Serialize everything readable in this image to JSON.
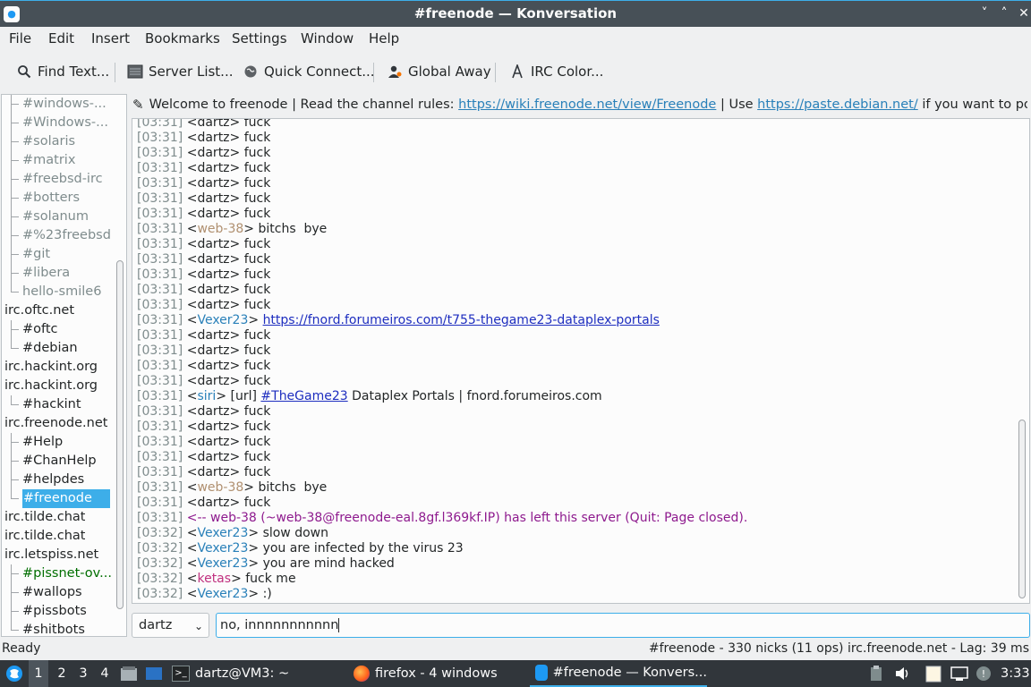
{
  "window": {
    "title": "#freenode — Konversation",
    "minimize": "˅",
    "maximize": "˄",
    "close": "✕"
  },
  "menu": [
    "File",
    "Edit",
    "Insert",
    "Bookmarks",
    "Settings",
    "Window",
    "Help"
  ],
  "toolbar": {
    "find": "Find Text...",
    "server_list": "Server List...",
    "quick_connect": "Quick Connect...",
    "global_away": "Global Away",
    "irc_color": "IRC Color..."
  },
  "sidebar": {
    "items": [
      {
        "label": "#windows-...",
        "level": 1,
        "color": "#7f8c8d"
      },
      {
        "label": "#Windows-...",
        "level": 1,
        "color": "#7f8c8d"
      },
      {
        "label": "#solaris",
        "level": 1,
        "color": "#7f8c8d"
      },
      {
        "label": "#matrix",
        "level": 1,
        "color": "#7f8c8d"
      },
      {
        "label": "#freebsd-irc",
        "level": 1,
        "color": "#7f8c8d"
      },
      {
        "label": "#botters",
        "level": 1,
        "color": "#7f8c8d"
      },
      {
        "label": "#solanum",
        "level": 1,
        "color": "#7f8c8d"
      },
      {
        "label": "#%23freebsd",
        "level": 1,
        "color": "#7f8c8d"
      },
      {
        "label": "#git",
        "level": 1,
        "color": "#7f8c8d"
      },
      {
        "label": "#libera",
        "level": 1,
        "color": "#7f8c8d"
      },
      {
        "label": "hello-smile6",
        "level": 1,
        "color": "#7f8c8d"
      },
      {
        "label": "irc.oftc.net",
        "level": 0,
        "color": "#232627"
      },
      {
        "label": "#oftc",
        "level": 1,
        "color": "#232627"
      },
      {
        "label": "#debian",
        "level": 1,
        "color": "#232627"
      },
      {
        "label": "irc.hackint.org",
        "level": 0,
        "color": "#232627"
      },
      {
        "label": "irc.hackint.org",
        "level": 0,
        "color": "#232627"
      },
      {
        "label": "#hackint",
        "level": 1,
        "color": "#232627"
      },
      {
        "label": "irc.freenode.net",
        "level": 0,
        "color": "#232627"
      },
      {
        "label": "#Help",
        "level": 1,
        "color": "#232627"
      },
      {
        "label": "#ChanHelp",
        "level": 1,
        "color": "#232627"
      },
      {
        "label": "#helpdes",
        "level": 1,
        "color": "#232627"
      },
      {
        "label": "#freenode",
        "level": 1,
        "color": "#ffffff",
        "selected": true
      },
      {
        "label": "irc.tilde.chat",
        "level": 0,
        "color": "#232627"
      },
      {
        "label": "irc.tilde.chat",
        "level": 0,
        "color": "#232627"
      },
      {
        "label": "irc.letspiss.net",
        "level": 0,
        "color": "#232627"
      },
      {
        "label": "#pissnet-ov...",
        "level": 1,
        "color": "#006e00"
      },
      {
        "label": "#wallops",
        "level": 1,
        "color": "#232627"
      },
      {
        "label": "#pissbots",
        "level": 1,
        "color": "#232627"
      },
      {
        "label": "#shitbots",
        "level": 1,
        "color": "#232627"
      }
    ]
  },
  "topic": {
    "prefix": "Welcome to freenode | Read the channel rules: ",
    "link1": "https://wiki.freenode.net/view/Freenode",
    "middle": " | Use ",
    "link2": "https://paste.debian.net/",
    "suffix": " if you want to post ..."
  },
  "chat": [
    {
      "ts": "[03:31]",
      "nick": "dartz",
      "text": "fuck"
    },
    {
      "ts": "[03:31]",
      "nick": "dartz",
      "text": "fuck"
    },
    {
      "ts": "[03:31]",
      "nick": "dartz",
      "text": "fuck"
    },
    {
      "ts": "[03:31]",
      "nick": "dartz",
      "text": "fuck"
    },
    {
      "ts": "[03:31]",
      "nick": "dartz",
      "text": "fuck"
    },
    {
      "ts": "[03:31]",
      "nick": "dartz",
      "text": "fuck"
    },
    {
      "ts": "[03:31]",
      "nick": "dartz",
      "text": "fuck"
    },
    {
      "ts": "[03:31]",
      "nick": "web-38",
      "nick_color": "#b09070",
      "text": "bitchs  bye"
    },
    {
      "ts": "[03:31]",
      "nick": "dartz",
      "text": "fuck"
    },
    {
      "ts": "[03:31]",
      "nick": "dartz",
      "text": "fuck"
    },
    {
      "ts": "[03:31]",
      "nick": "dartz",
      "text": "fuck"
    },
    {
      "ts": "[03:31]",
      "nick": "dartz",
      "text": "fuck"
    },
    {
      "ts": "[03:31]",
      "nick": "dartz",
      "text": "fuck"
    },
    {
      "ts": "[03:31]",
      "nick": "Vexer23",
      "nick_color": "#2980b9",
      "link": "https://fnord.forumeiros.com/t755-thegame23-dataplex-portals"
    },
    {
      "ts": "[03:31]",
      "nick": "dartz",
      "text": "fuck"
    },
    {
      "ts": "[03:31]",
      "nick": "dartz",
      "text": "fuck"
    },
    {
      "ts": "[03:31]",
      "nick": "dartz",
      "text": "fuck"
    },
    {
      "ts": "[03:31]",
      "nick": "dartz",
      "text": "fuck"
    },
    {
      "ts": "[03:31]",
      "nick": "siri",
      "nick_color": "#2980b9",
      "pre": "[url] ",
      "link": "#TheGame23",
      "text": " Dataplex Portals | fnord.forumeiros.com"
    },
    {
      "ts": "[03:31]",
      "nick": "dartz",
      "text": "fuck"
    },
    {
      "ts": "[03:31]",
      "nick": "dartz",
      "text": "fuck"
    },
    {
      "ts": "[03:31]",
      "nick": "dartz",
      "text": "fuck"
    },
    {
      "ts": "[03:31]",
      "nick": "dartz",
      "text": "fuck"
    },
    {
      "ts": "[03:31]",
      "nick": "dartz",
      "text": "fuck"
    },
    {
      "ts": "[03:31]",
      "nick": "web-38",
      "nick_color": "#b09070",
      "text": "bitchs  bye"
    },
    {
      "ts": "[03:31]",
      "nick": "dartz",
      "text": "fuck"
    },
    {
      "ts": "[03:31]",
      "event": "<-- web-38 (~web-38@freenode-eal.8gf.l369kf.IP) has left this server (Quit: Page closed).",
      "event_color": "#8e1a8e"
    },
    {
      "ts": "[03:32]",
      "nick": "Vexer23",
      "nick_color": "#2980b9",
      "text": "slow down"
    },
    {
      "ts": "[03:32]",
      "nick": "Vexer23",
      "nick_color": "#2980b9",
      "text": "you are infected by the virus 23"
    },
    {
      "ts": "[03:32]",
      "nick": "Vexer23",
      "nick_color": "#2980b9",
      "text": "you are mind hacked"
    },
    {
      "ts": "[03:32]",
      "nick": "ketas",
      "nick_color": "#c0307f",
      "text": "fuck me"
    },
    {
      "ts": "[03:32]",
      "nick": "Vexer23",
      "nick_color": "#2980b9",
      "text": ":)"
    }
  ],
  "input": {
    "nick": "dartz",
    "value": "no, innnnnnnnnnn"
  },
  "status": {
    "left": "Ready",
    "right": "#freenode - 330 nicks (11 ops)  irc.freenode.net - Lag: 39 ms"
  },
  "taskbar": {
    "desktops": [
      "1",
      "2",
      "3",
      "4"
    ],
    "terminal": "dartz@VM3: ~",
    "firefox": "firefox - 4 windows",
    "konversation": "#freenode — Konvers...",
    "clock": "3:33"
  },
  "colors": {
    "accent": "#3daee9",
    "selected": "#3daee9",
    "link": "#2980b9"
  }
}
